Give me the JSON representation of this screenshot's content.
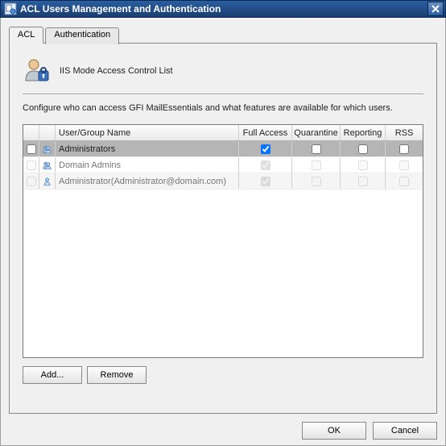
{
  "window": {
    "title": "ACL Users Management and Authentication"
  },
  "tabs": {
    "acl": "ACL",
    "auth": "Authentication"
  },
  "header": {
    "title": "IIS Mode Access Control List",
    "desc": "Configure who can access GFI MailEssentials and what features are available for which users."
  },
  "columns": {
    "name": "User/Group Name",
    "full": "Full Access",
    "quarantine": "Quarantine",
    "reporting": "Reporting",
    "rss": "RSS"
  },
  "rows": [
    {
      "name": "Administrators",
      "selected": true,
      "type": "group",
      "flag": false,
      "full": true,
      "quarantine": false,
      "reporting": false,
      "rss": false,
      "disabled": false
    },
    {
      "name": "Domain Admins",
      "selected": false,
      "type": "group",
      "flag": false,
      "full": true,
      "quarantine": false,
      "reporting": false,
      "rss": false,
      "disabled": true
    },
    {
      "name": "Administrator(Administrator@domain.com)",
      "selected": false,
      "type": "user",
      "flag": false,
      "full": true,
      "quarantine": false,
      "reporting": false,
      "rss": false,
      "disabled": true
    }
  ],
  "buttons": {
    "add": "Add...",
    "remove": "Remove",
    "ok": "OK",
    "cancel": "Cancel"
  }
}
